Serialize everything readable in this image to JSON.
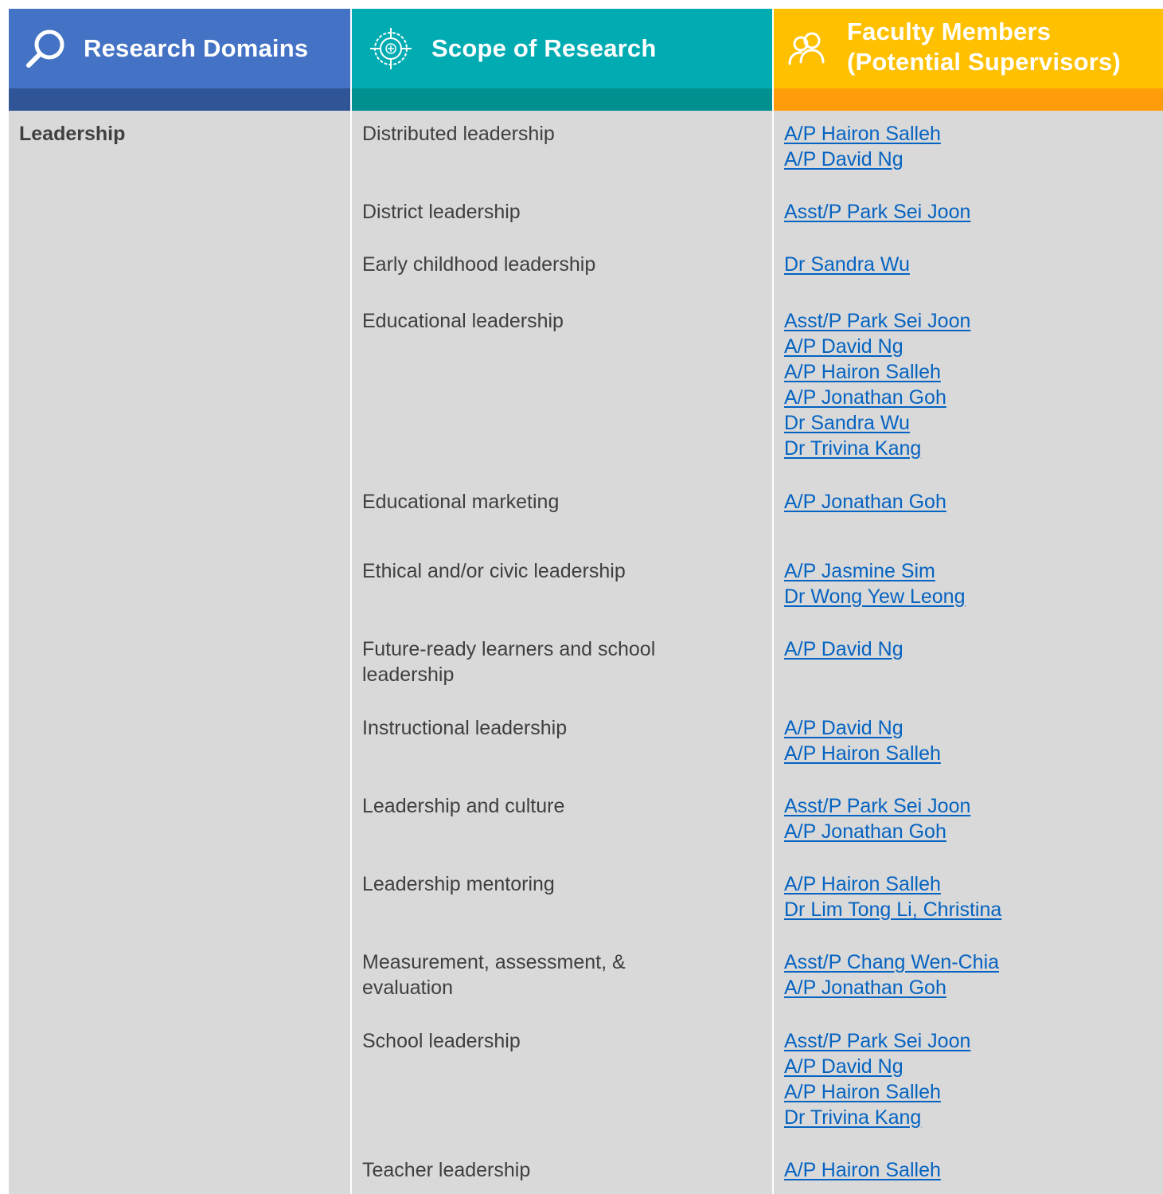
{
  "header": {
    "domains_title": "Research Domains",
    "scope_title": "Scope of Research",
    "faculty_title_line1": "Faculty Members",
    "faculty_title_line2": "(Potential Supervisors)"
  },
  "domain": "Leadership",
  "rows": [
    {
      "scope": "Distributed leadership",
      "supervisors": [
        "A/P Hairon Salleh",
        "A/P David Ng"
      ]
    },
    {
      "scope": "District leadership",
      "supervisors": [
        "Asst/P Park Sei Joon"
      ]
    },
    {
      "scope": "Early childhood leadership",
      "supervisors": [
        "Dr Sandra Wu"
      ]
    },
    {
      "scope": "Educational leadership",
      "supervisors": [
        "Asst/P Park Sei Joon",
        "A/P David Ng",
        "A/P Hairon Salleh",
        "A/P Jonathan Goh",
        "Dr Sandra Wu",
        "Dr Trivina Kang"
      ]
    },
    {
      "scope": "Educational marketing",
      "supervisors": [
        "A/P Jonathan Goh"
      ]
    },
    {
      "scope": "Ethical and/or civic leadership",
      "supervisors": [
        "A/P Jasmine Sim",
        "Dr Wong Yew Leong"
      ]
    },
    {
      "scope": "Future-ready learners and school leadership",
      "supervisors": [
        "A/P David Ng"
      ]
    },
    {
      "scope": "Instructional leadership",
      "supervisors": [
        "A/P David Ng",
        "A/P Hairon Salleh"
      ]
    },
    {
      "scope": "Leadership and culture",
      "supervisors": [
        "Asst/P Park Sei Joon",
        "A/P Jonathan Goh"
      ]
    },
    {
      "scope": "Leadership mentoring",
      "supervisors": [
        "A/P Hairon Salleh",
        "Dr Lim Tong Li, Christina"
      ]
    },
    {
      "scope": "Measurement, assessment, & evaluation",
      "supervisors": [
        "Asst/P Chang Wen-Chia",
        "A/P Jonathan Goh"
      ]
    },
    {
      "scope": "School leadership",
      "supervisors": [
        "Asst/P Park Sei Joon",
        "A/P David Ng",
        "A/P Hairon Salleh",
        "Dr Trivina Kang"
      ]
    },
    {
      "scope": "Teacher leadership",
      "supervisors": [
        "A/P Hairon Salleh"
      ]
    }
  ],
  "icons": {
    "domains": "search-icon",
    "scope": "target-icon",
    "faculty": "people-icon"
  },
  "colors": {
    "domains_header": "#4472c4",
    "scope_header": "#00acb2",
    "faculty_header": "#ffc000",
    "cell_background": "#d9d9d9",
    "link": "#0563c1"
  }
}
